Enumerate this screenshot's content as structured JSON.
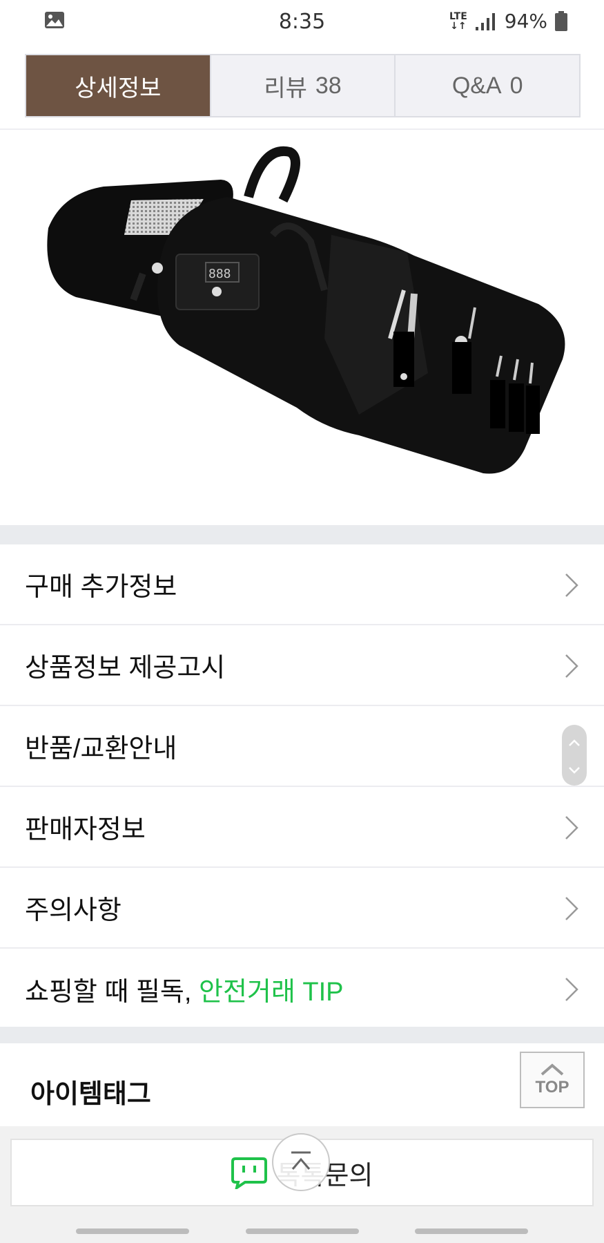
{
  "status_bar": {
    "time": "8:35",
    "network": "LTE",
    "battery": "94%",
    "icons": [
      "gallery-icon",
      "signal-icon",
      "battery-icon"
    ]
  },
  "tabs": [
    {
      "label": "상세정보",
      "count": "",
      "active": true
    },
    {
      "label": "리뷰",
      "count": "38",
      "active": false
    },
    {
      "label": "Q&A",
      "count": "0",
      "active": false
    }
  ],
  "menu": {
    "items": [
      {
        "label": "구매 추가정보"
      },
      {
        "label": "상품정보 제공고시"
      },
      {
        "label": "반품/교환안내"
      },
      {
        "label": "판매자정보"
      },
      {
        "label": "주의사항"
      },
      {
        "label": "쇼핑할 때 필독, ",
        "highlight": "안전거래 TIP"
      }
    ]
  },
  "item_tag": {
    "title": "아이템태그",
    "top_label": "TOP"
  },
  "bottom": {
    "talk_label": "톡톡문의"
  },
  "colors": {
    "active_tab": "#6e5443",
    "highlight_green": "#1fc24a",
    "talk_green": "#1fc24a"
  }
}
